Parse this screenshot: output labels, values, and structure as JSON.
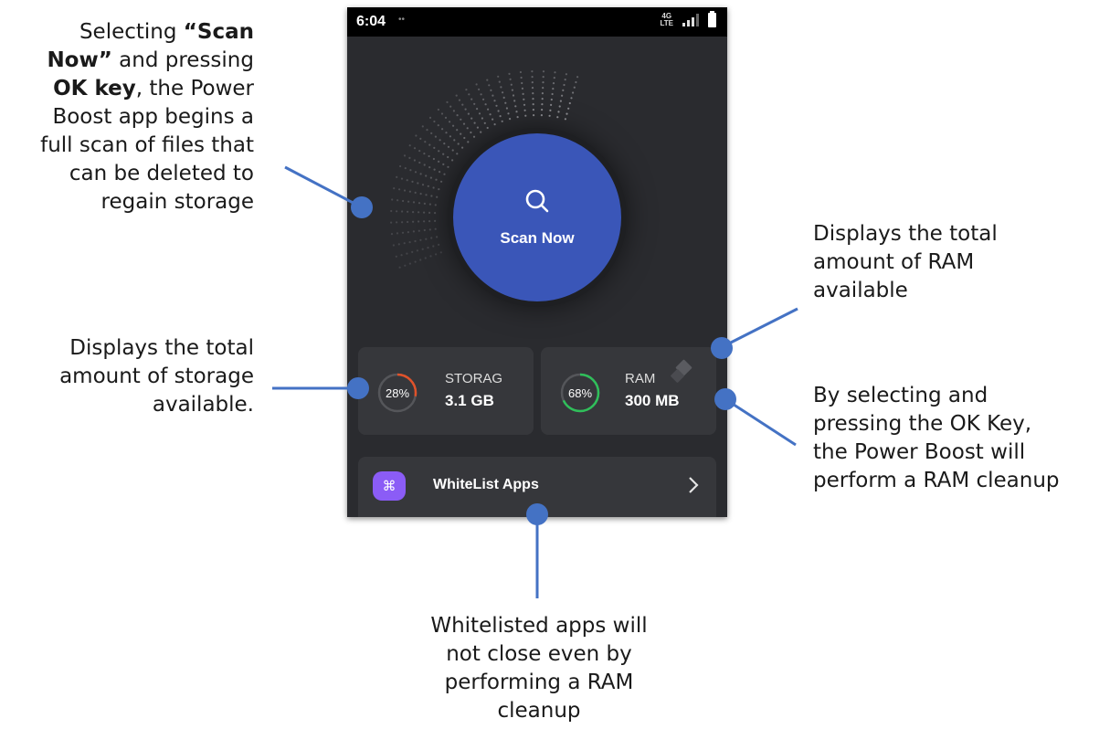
{
  "callouts": {
    "scan": {
      "lines": [
        {
          "before": "Selecting ",
          "strong": "“Scan",
          "after": ""
        },
        {
          "before": "",
          "strong": "Now”",
          "after": " and pressing"
        },
        {
          "before": "",
          "strong": "OK key",
          "after": ", the Power"
        },
        {
          "before": "Boost app begins a",
          "strong": "",
          "after": ""
        },
        {
          "before": "full scan of files that",
          "strong": "",
          "after": ""
        },
        {
          "before": "can be deleted to",
          "strong": "",
          "after": ""
        },
        {
          "before": "regain storage",
          "strong": "",
          "after": ""
        }
      ]
    },
    "storage": [
      "Displays the total",
      "amount of storage",
      "available."
    ],
    "ram_total": [
      "Displays the total",
      "amount of RAM",
      "available"
    ],
    "ram_cleanup": [
      "By selecting and",
      "pressing the OK Key,",
      "the Power Boost will",
      "perform a RAM cleanup"
    ],
    "whitelist": [
      "Whitelisted apps will",
      "not close even by",
      "performing a RAM",
      "cleanup"
    ]
  },
  "phone": {
    "status": {
      "time": "6:04",
      "indicator": "••",
      "network_top": "4G",
      "network_bottom": "LTE"
    },
    "scan_button": {
      "label": "Scan Now",
      "icon": "search-icon"
    },
    "storage_card": {
      "percent": "28%",
      "percent_value": 28,
      "title": "STORAG",
      "value": "3.1 GB",
      "ring_color": "#e0522a"
    },
    "ram_card": {
      "percent": "68%",
      "percent_value": 68,
      "title": "RAM",
      "value": "300 MB",
      "ring_color": "#2fbf5a",
      "icon": "eraser-icon"
    },
    "whitelist": {
      "label": "WhiteList Apps",
      "icon": "command-icon",
      "icon_glyph": "⌘",
      "icon_color": "#8b5cf6",
      "chevron": "chevron-right-icon"
    }
  },
  "colors": {
    "pointer": "#4472c4",
    "phone_bg": "#2a2b2f",
    "button": "#3a56b8"
  }
}
